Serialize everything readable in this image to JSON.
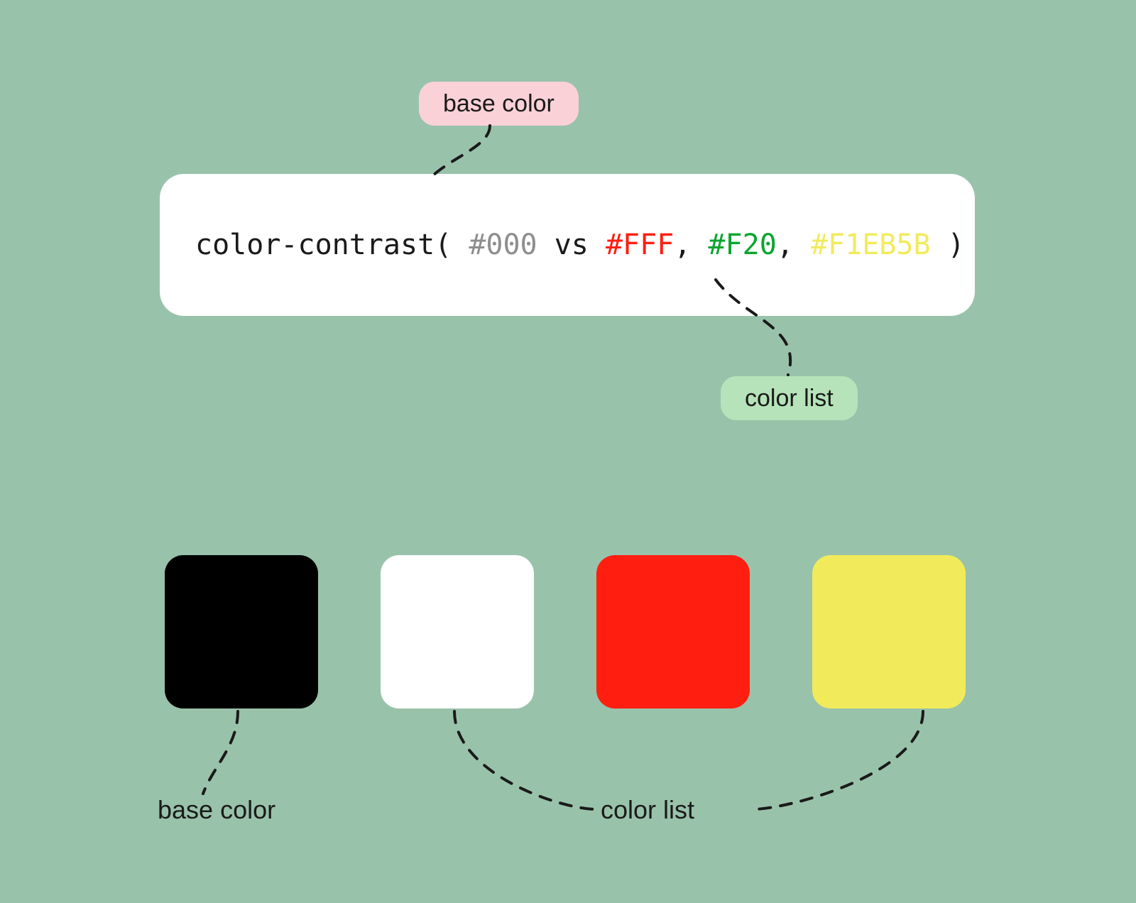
{
  "labels": {
    "base_color_pill": "base color",
    "color_list_pill": "color list",
    "base_color_caption": "base color",
    "color_list_caption": "color list"
  },
  "code": {
    "fn_open": "color-contrast( ",
    "base": "#000",
    "vs": " vs ",
    "c_white": "#FFF",
    "sep1": ", ",
    "c_orange": "#F20",
    "sep2": ", ",
    "c_yellow": "#F1EB5B",
    "fn_close": " )"
  },
  "swatches": {
    "base": "#000000",
    "white": "#FFFFFF",
    "orange": "#FF1e10",
    "yellow": "#F1EB5B"
  }
}
